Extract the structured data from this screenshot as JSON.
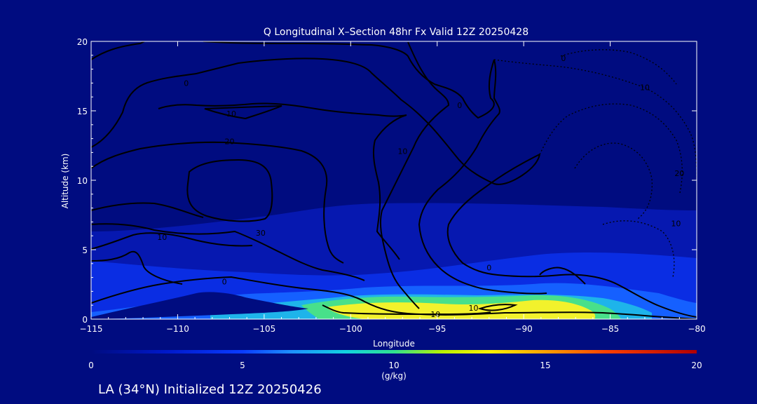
{
  "chart_data": {
    "type": "contour",
    "title": "Q Longitudinal X–Section 48hr  Fx Valid 12Z 20250428",
    "xlabel": "Longitude",
    "ylabel": "Altitude (km)",
    "xlim": [
      -115,
      -80
    ],
    "ylim": [
      0,
      20
    ],
    "x_ticks": [
      -115,
      -110,
      -105,
      -100,
      -95,
      -90,
      -85,
      -80
    ],
    "x_tick_labels": [
      "−115",
      "−110",
      "−105",
      "−100",
      "−95",
      "−90",
      "−85",
      "−80"
    ],
    "y_ticks": [
      0,
      5,
      10,
      15,
      20
    ],
    "y_tick_labels": [
      "0",
      "5",
      "10",
      "15",
      "20"
    ],
    "colorbar": {
      "label": "(g/kg)",
      "range": [
        0,
        20
      ],
      "ticks": [
        "0",
        "5",
        "10",
        "15",
        "20"
      ]
    },
    "contour_labels": [
      {
        "text": "0",
        "x": -109.5,
        "y": 17.0
      },
      {
        "text": "10",
        "x": -106.9,
        "y": 14.8
      },
      {
        "text": "20",
        "x": -107.0,
        "y": 12.8
      },
      {
        "text": "10",
        "x": -110.9,
        "y": 5.9
      },
      {
        "text": "30",
        "x": -105.2,
        "y": 6.2
      },
      {
        "text": "0",
        "x": -107.3,
        "y": 2.7
      },
      {
        "text": "10",
        "x": -97.0,
        "y": 12.1
      },
      {
        "text": "0",
        "x": -93.7,
        "y": 15.4
      },
      {
        "text": "10",
        "x": -95.1,
        "y": 0.35
      },
      {
        "text": "10",
        "x": -92.9,
        "y": 0.8
      },
      {
        "text": "0",
        "x": -92.0,
        "y": 3.7
      },
      {
        "text": "10",
        "x": -83.0,
        "y": 16.7
      },
      {
        "text": "20",
        "x": -81.0,
        "y": 10.5
      },
      {
        "text": "10",
        "x": -81.2,
        "y": 6.9
      },
      {
        "text": "0",
        "x": -87.7,
        "y": 18.8
      }
    ]
  },
  "footer": {
    "caption": "LA (34°N) Initialized 12Z 20250426"
  }
}
